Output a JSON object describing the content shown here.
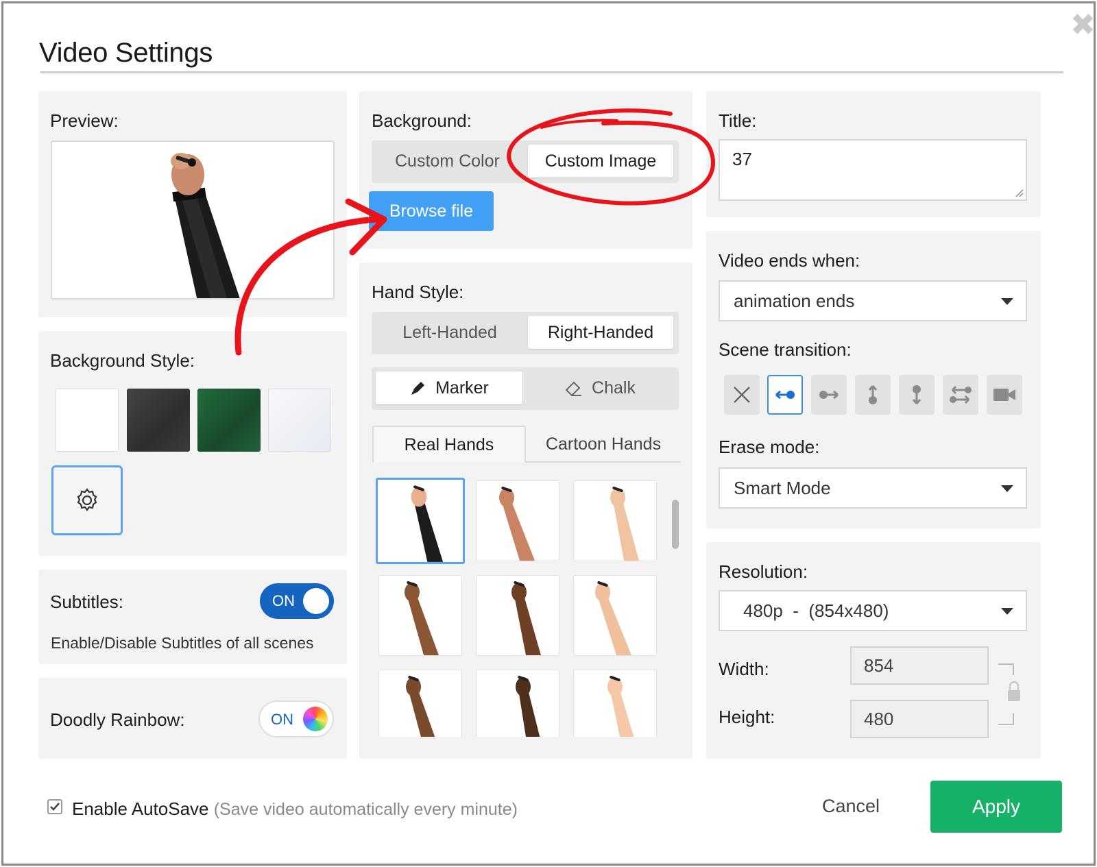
{
  "dialog": {
    "title": "Video Settings",
    "close_symbol": "✖"
  },
  "preview": {
    "label": "Preview:"
  },
  "background_style": {
    "label": "Background Style:",
    "swatches": [
      {
        "name": "white",
        "color": "#ffffff"
      },
      {
        "name": "dark-grey",
        "color": "#3a3a3c"
      },
      {
        "name": "green",
        "color": "#1f5b34"
      },
      {
        "name": "light",
        "color": "#eef0f6"
      }
    ]
  },
  "subtitles": {
    "label": "Subtitles:",
    "toggle": "ON",
    "description": "Enable/Disable Subtitles of all scenes"
  },
  "rainbow": {
    "label": "Doodly Rainbow:",
    "toggle": "ON"
  },
  "background": {
    "label": "Background:",
    "options": [
      "Custom Color",
      "Custom Image"
    ],
    "selected": "Custom Image",
    "browse_label": "Browse file"
  },
  "hand_style": {
    "label": "Hand Style:",
    "handedness": [
      "Left-Handed",
      "Right-Handed"
    ],
    "tools": [
      "Marker",
      "Chalk"
    ],
    "tabs": [
      "Real Hands",
      "Cartoon Hands"
    ],
    "skin_tones": [
      "#e9b08f",
      "#c98463",
      "#f0c4a1",
      "#8a5634",
      "#6e4127",
      "#f0bf9c",
      "#7a4a2c",
      "#4e2f1c",
      "#f5c9a8"
    ]
  },
  "title": {
    "label": "Title:",
    "value": "37"
  },
  "video_ends": {
    "label": "Video ends when:",
    "value": "animation ends"
  },
  "scene_transition": {
    "label": "Scene transition:"
  },
  "erase_mode": {
    "label": "Erase mode:",
    "value": "Smart Mode"
  },
  "resolution": {
    "label": "Resolution:",
    "value": "480p  -  (854x480)",
    "width_label": "Width:",
    "width_value": "854",
    "height_label": "Height:",
    "height_value": "480"
  },
  "footer": {
    "autosave_label": "Enable AutoSave",
    "autosave_hint": "(Save video automatically every minute)",
    "cancel": "Cancel",
    "apply": "Apply"
  },
  "colors": {
    "accent_blue": "#42a0f5",
    "toggle_blue": "#1565c0",
    "apply_green": "#17b26a",
    "annotation_red": "#e8141c"
  }
}
